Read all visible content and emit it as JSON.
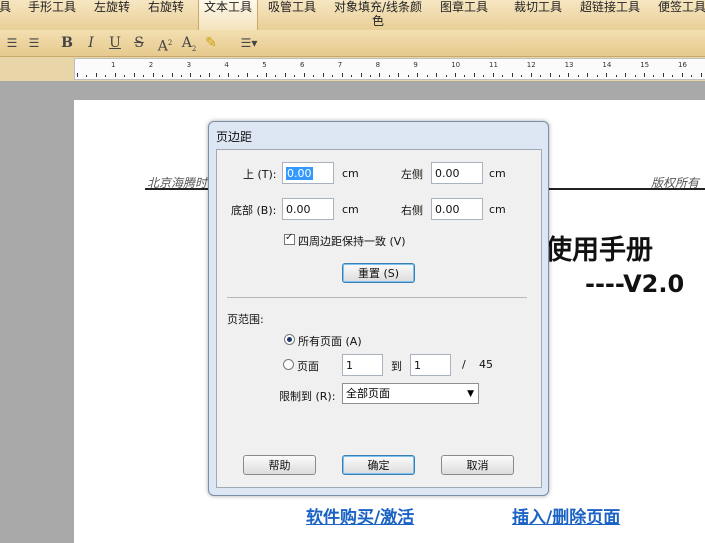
{
  "toolbar": {
    "tabs": [
      "具",
      "手形工具",
      "左旋转",
      "右旋转",
      "文本工具",
      "吸管工具",
      "对象填充/线条颜色",
      "图章工具",
      "裁切工具",
      "超链接工具",
      "便签工具"
    ],
    "active_tab": "文本工具"
  },
  "ruler": {
    "numbers": [
      "1",
      "2",
      "3",
      "4",
      "5",
      "6",
      "7",
      "8",
      "9",
      "10",
      "11",
      "12",
      "13",
      "14",
      "15",
      "16"
    ]
  },
  "document": {
    "header_left": "北京海腾时",
    "header_right": "版权所有",
    "title": "使用手册",
    "version": "----V2.0",
    "link_buy": "软件购买/激活",
    "link_insert": "插入/删除页面"
  },
  "dialog": {
    "title": "页边距",
    "top_label": "上 (T):",
    "top_value": "0.00",
    "left_label": "左侧",
    "left_value": "0.00",
    "bottom_label": "底部 (B):",
    "bottom_value": "0.00",
    "right_label": "右侧",
    "right_value": "0.00",
    "unit": "cm",
    "uniform_label": "四周边距保持一致 (V)",
    "reset_label": "重置 (S)",
    "range_label": "页范围:",
    "all_pages_label": "所有页面 (A)",
    "pages_label": "页面",
    "from_value": "1",
    "to_label": "到",
    "to_value": "1",
    "slash": "/",
    "total": "45",
    "limit_label": "限制到 (R):",
    "limit_value": "全部页面",
    "help_label": "帮助",
    "ok_label": "确定",
    "cancel_label": "取消"
  }
}
